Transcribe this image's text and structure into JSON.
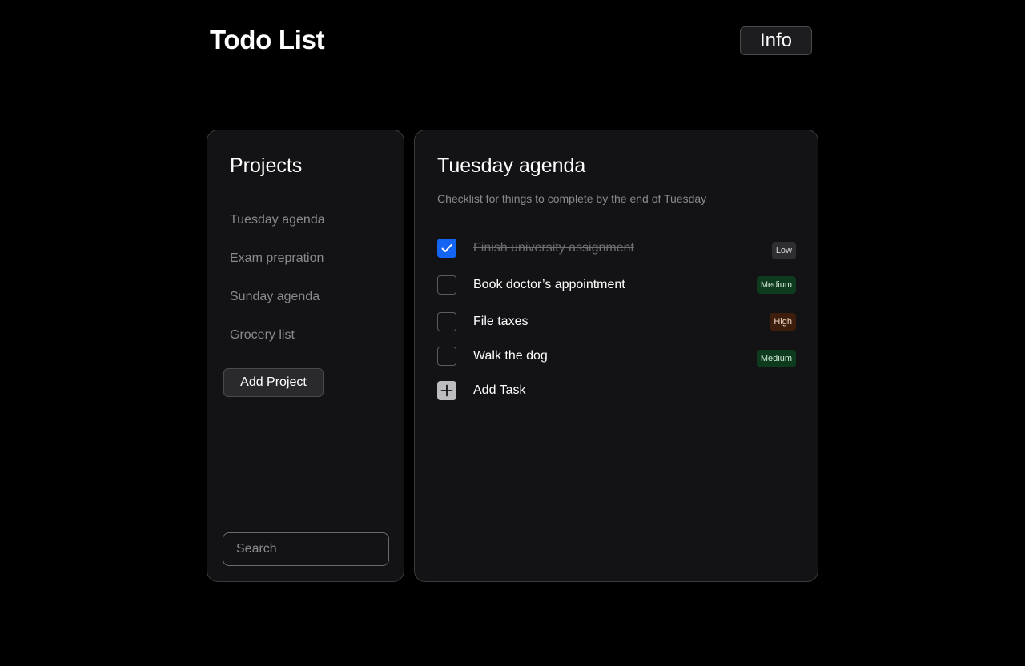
{
  "header": {
    "title": "Todo List",
    "info_label": "Info"
  },
  "sidebar": {
    "heading": "Projects",
    "projects": [
      {
        "label": "Tuesday agenda"
      },
      {
        "label": "Exam prepration"
      },
      {
        "label": "Sunday agenda"
      },
      {
        "label": "Grocery list"
      }
    ],
    "add_project_label": "Add Project",
    "search": {
      "placeholder": "Search",
      "value": ""
    }
  },
  "main": {
    "title": "Tuesday agenda",
    "subtitle": "Checklist for things to complete by the end of Tuesday",
    "tasks": [
      {
        "label": "Finish university assignment",
        "done": true,
        "priority": "Low"
      },
      {
        "label": "Book doctor’s appointment",
        "done": false,
        "priority": "Medium"
      },
      {
        "label": "File taxes",
        "done": false,
        "priority": "High"
      },
      {
        "label": "Walk the dog",
        "done": false,
        "priority": "Medium"
      }
    ],
    "add_task_label": "Add Task"
  },
  "icons": {
    "checked": "check-icon",
    "add": "plus-icon"
  },
  "colors": {
    "background": "#000000",
    "panel": "#131214",
    "accent_checkbox": "#1464f4",
    "priority_low_bg": "#2e2d30",
    "priority_low_text": "#d8d7da",
    "priority_medium_bg": "#0e3a1e",
    "priority_medium_text": "#cfe8d6",
    "priority_high_bg": "#3d1e0c",
    "priority_high_text": "#f0d7c6"
  }
}
